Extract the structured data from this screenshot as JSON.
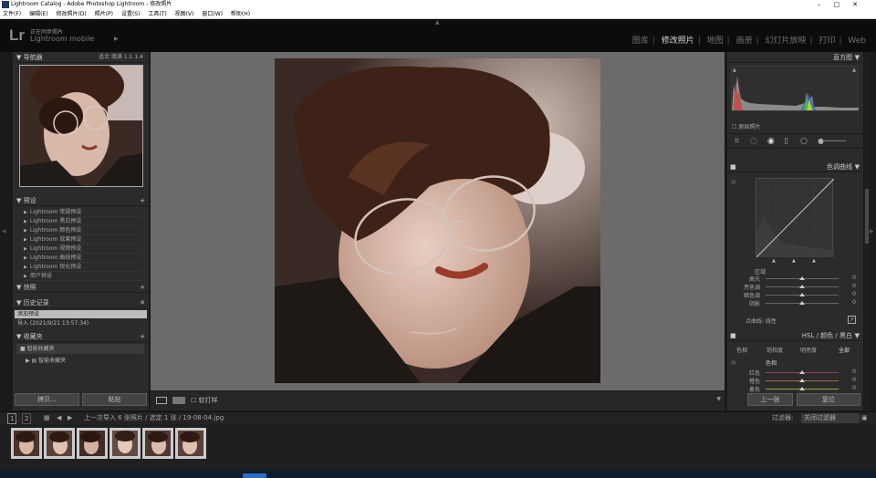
{
  "window": {
    "title": "Lightroom Catalog - Adobe Photoshop Lightroom - 修改照片",
    "controls": [
      "–",
      "□",
      "✕"
    ]
  },
  "menu": [
    "文件(F)",
    "编辑(E)",
    "修改照片(D)",
    "照片(P)",
    "设置(S)",
    "工具(T)",
    "视图(V)",
    "窗口(W)",
    "帮助(H)"
  ],
  "identity": {
    "logo": "Lr",
    "catalog": "正在同步照片",
    "mobile": "Lightroom mobile",
    "modules": [
      "图库",
      "修改照片",
      "地图",
      "画册",
      "幻灯片放映",
      "打印",
      "Web"
    ],
    "active_module": "修改照片"
  },
  "left": {
    "navigator": {
      "title": "导航器",
      "controls": "适合  填满  1:1  1:4"
    },
    "presets": {
      "title": "预设",
      "items": [
        "Lightroom 常规预设",
        "Lightroom 黑白预设",
        "Lightroom 颜色预设",
        "Lightroom 效果预设",
        "Lightroom 视频预设",
        "Lightroom 曲线预设",
        "Lightroom 锐化预设",
        "用户预设"
      ]
    },
    "snapshots": {
      "title": "快照"
    },
    "history": {
      "title": "历史记录",
      "items": [
        "添加预设",
        "导入 (2021/9/21 13:57:34)"
      ]
    },
    "collections": {
      "title": "收藏夹",
      "items": [
        "智能收藏夹",
        "智能收藏夹"
      ]
    },
    "buttons": {
      "copy": "拷贝...",
      "paste": "粘贴"
    }
  },
  "toolbar": {
    "soft_proof": "软打样"
  },
  "right": {
    "histogram": {
      "title": "直方图",
      "original": "原始照片"
    },
    "tone_curve": {
      "title": "色调曲线",
      "region": "区域",
      "sliders": [
        {
          "label": "高光",
          "value": "0",
          "pos": 0.5
        },
        {
          "label": "亮色调",
          "value": "0",
          "pos": 0.5
        },
        {
          "label": "暗色调",
          "value": "0",
          "pos": 0.5
        },
        {
          "label": "阴影",
          "value": "0",
          "pos": 0.5
        }
      ],
      "channel": "点曲线: 线性"
    },
    "hsl": {
      "title": "HSL / 颜色 / 黑白",
      "tabs": [
        "色相",
        "饱和度",
        "明亮度",
        "全部"
      ],
      "subtitle": "色相",
      "sliders": [
        {
          "label": "红色",
          "value": "0",
          "pos": 0.5
        },
        {
          "label": "橙色",
          "value": "0",
          "pos": 0.5
        },
        {
          "label": "黄色",
          "value": "0",
          "pos": 0.5
        }
      ]
    },
    "buttons": {
      "prev": "上一张",
      "reset": "复位"
    }
  },
  "filmbar": {
    "page1": "1",
    "page2": "2",
    "path": "上一次导入  6 张照片 / 选定 1 张 / 19-08-04.jpg",
    "filter_label": "过滤器:",
    "filter_value": "关闭过滤器"
  },
  "filmstrip": {
    "count": 6
  }
}
